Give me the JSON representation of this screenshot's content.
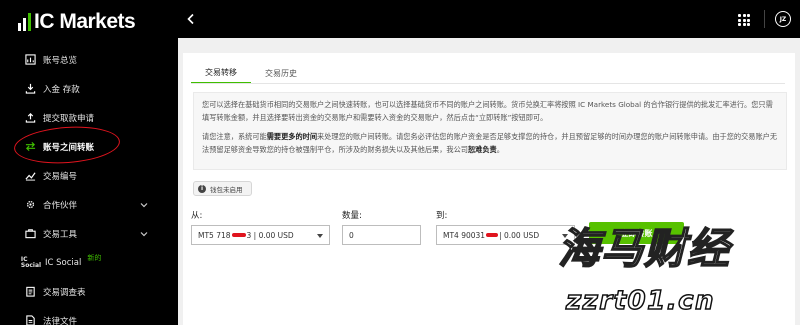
{
  "brand": {
    "logo_text": "IC Markets",
    "accent_color": "#3fbf00"
  },
  "sidebar": {
    "items": [
      {
        "label": "账号总览",
        "icon": "chart-icon"
      },
      {
        "label": "入金 存款",
        "icon": "download-icon"
      },
      {
        "label": "提交取款申请",
        "icon": "upload-icon"
      },
      {
        "label": "账号之间转账",
        "icon": "transfer-arrows-icon",
        "active": true
      },
      {
        "label": "交易编号",
        "icon": "trend-icon"
      },
      {
        "label": "合作伙伴",
        "icon": "gear-icon",
        "expandable": true
      },
      {
        "label": "交易工具",
        "icon": "briefcase-icon",
        "expandable": true
      },
      {
        "label": "IC Social",
        "icon": "ic-social-icon",
        "icon_text": "IC Social",
        "badge": "新的"
      },
      {
        "label": "交易调查表",
        "icon": "clipboard-icon"
      },
      {
        "label": "法律文件",
        "icon": "document-icon"
      }
    ]
  },
  "topbar": {
    "avatar_initials": "JZ"
  },
  "tabs": [
    {
      "label": "交易转移",
      "active": true
    },
    {
      "label": "交易历史",
      "active": false
    }
  ],
  "info": {
    "para1": "您可以选择在基础货币相同的交易账户之间快速转账，也可以选择基础货币不同的账户之间转账。货币兑换汇率将按照 IC Markets Global 的合作银行提供的批发汇率进行。您只需填写转账金额，并且选择要转出资金的交易账户和需要转入资金的交易账户，然后点击“立即转账”按钮即可。",
    "para2_before": "请您注意，系统可能",
    "para2_bold": "需要更多的时间",
    "para2_after": "来处理您的账户间转账。请您务必评估您的账户资金是否足够支撑您的持仓，并且预留足够的时间办理您的账户间转账申请。由于您的交易账户无法预留足够资金导致您的持仓被强制平仓，所涉及的财务损失以及其他后果，我公司",
    "para2_bold2": "恕难负责",
    "para2_end": "。"
  },
  "wallet_notice": {
    "icon_text": "i",
    "label": "钱包未启用"
  },
  "form": {
    "from_label": "从:",
    "from_prefix": "MT5 718",
    "from_suffix": "3 | 0.00 USD",
    "amount_label": "数量:",
    "amount_value": "0",
    "to_label": "到:",
    "to_prefix": "MT4 90031",
    "to_suffix": "| 0.00 USD",
    "submit_label": "立即转账"
  },
  "watermark": {
    "main": "海马财经",
    "url": "zzrt01.cn"
  }
}
